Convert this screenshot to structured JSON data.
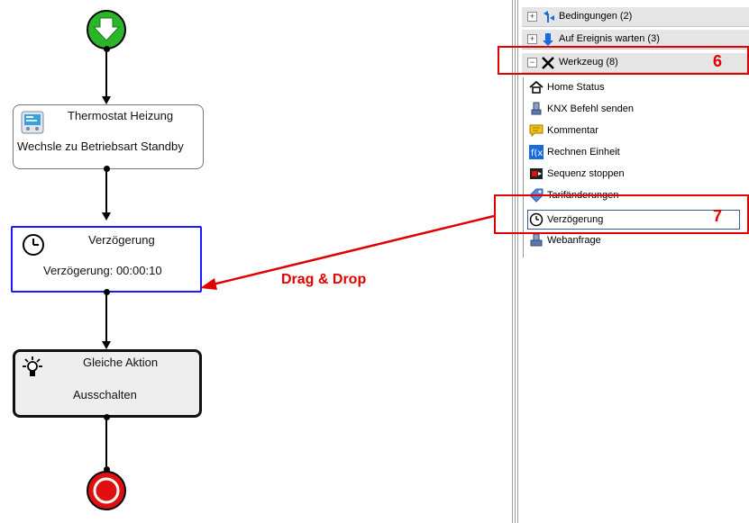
{
  "flow": {
    "nodes": [
      {
        "title": "Thermostat Heizung",
        "body": "Wechsle zu Betriebsart Standby"
      },
      {
        "title": "Verzögerung",
        "body": "Verzögerung: 00:00:10"
      },
      {
        "title": "Gleiche Aktion",
        "body": "Ausschalten"
      }
    ],
    "drag_label": "Drag & Drop"
  },
  "toolbox": {
    "groups": [
      {
        "label": "Bedingungen (2)",
        "icon": "conditions-icon",
        "expanded": false
      },
      {
        "label": "Auf Ereignis warten (3)",
        "icon": "wait-event-icon",
        "expanded": false
      },
      {
        "label": "Werkzeug (8)",
        "icon": "tools-icon",
        "expanded": true
      }
    ],
    "items": [
      {
        "label": "Home Status",
        "icon": "home-icon"
      },
      {
        "label": "KNX Befehl senden",
        "icon": "knx-icon"
      },
      {
        "label": "Kommentar",
        "icon": "comment-icon"
      },
      {
        "label": "Rechnen Einheit",
        "icon": "calculate-icon"
      },
      {
        "label": "Sequenz stoppen",
        "icon": "stop-sequence-icon"
      },
      {
        "label": "Tarifänderungen",
        "icon": "tariff-icon"
      },
      {
        "label": "Verzögerung",
        "icon": "clock-icon"
      },
      {
        "label": "Webanfrage",
        "icon": "web-request-icon"
      }
    ]
  },
  "callouts": {
    "six": "6",
    "seven": "7"
  },
  "colors": {
    "callout_red": "#e00000",
    "selection_blue": "#1a1aff",
    "start_green": "#2bb52b",
    "end_red": "#e01010"
  }
}
